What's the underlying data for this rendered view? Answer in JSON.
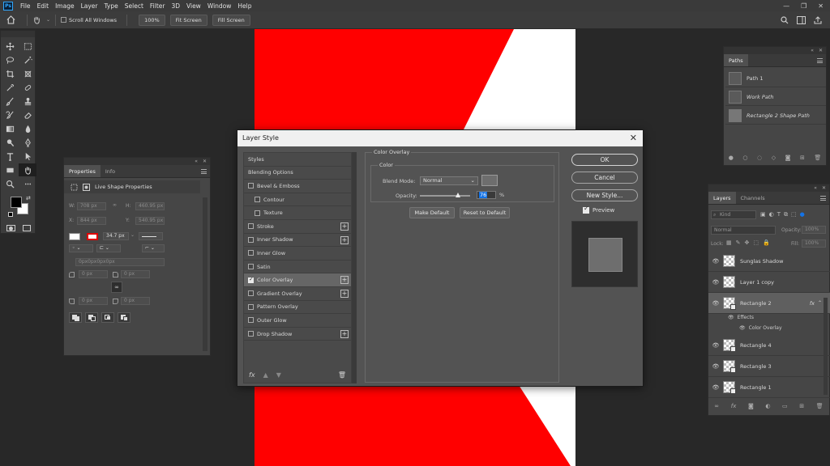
{
  "menubar": {
    "logo": "Ps",
    "items": [
      "File",
      "Edit",
      "Image",
      "Layer",
      "Type",
      "Select",
      "Filter",
      "3D",
      "View",
      "Window",
      "Help"
    ],
    "controls": [
      "—",
      "❐",
      "✕"
    ]
  },
  "options_bar": {
    "scroll_all_windows": "Scroll All Windows",
    "zoom": "100%",
    "fit_screen": "Fit Screen",
    "fill_screen": "Fill Screen"
  },
  "properties": {
    "tabs": [
      "Properties",
      "Info"
    ],
    "header": "Live Shape Properties",
    "w_label": "W:",
    "w_value": "708 px",
    "h_label": "H:",
    "h_value": "460.95 px",
    "x_label": "X:",
    "x_value": "844 px",
    "y_label": "Y:",
    "y_value": "540.95 px",
    "stroke_width": "34.7 px",
    "corner_values": [
      "0 px",
      "0 px",
      "0 px",
      "0 px"
    ],
    "radius_placeholder": "0px0px0px0px"
  },
  "dialog": {
    "title": "Layer Style",
    "close": "✕",
    "styles": [
      {
        "label": "Styles",
        "kind": "header"
      },
      {
        "label": "Blending Options",
        "kind": "header"
      },
      {
        "label": "Bevel & Emboss",
        "kind": "check",
        "checked": false
      },
      {
        "label": "Contour",
        "kind": "sub",
        "checked": false
      },
      {
        "label": "Texture",
        "kind": "sub",
        "checked": false
      },
      {
        "label": "Stroke",
        "kind": "check",
        "checked": false,
        "plus": true
      },
      {
        "label": "Inner Shadow",
        "kind": "check",
        "checked": false,
        "plus": true
      },
      {
        "label": "Inner Glow",
        "kind": "check",
        "checked": false
      },
      {
        "label": "Satin",
        "kind": "check",
        "checked": false
      },
      {
        "label": "Color Overlay",
        "kind": "check",
        "checked": true,
        "plus": true,
        "active": true
      },
      {
        "label": "Gradient Overlay",
        "kind": "check",
        "checked": false,
        "plus": true
      },
      {
        "label": "Pattern Overlay",
        "kind": "check",
        "checked": false
      },
      {
        "label": "Outer Glow",
        "kind": "check",
        "checked": false
      },
      {
        "label": "Drop Shadow",
        "kind": "check",
        "checked": false,
        "plus": true
      }
    ],
    "fx": "fx",
    "section_title": "Color Overlay",
    "color_group": "Color",
    "blend_mode_label": "Blend Mode:",
    "blend_mode_value": "Normal",
    "overlay_color": "#6e6e6e",
    "opacity_label": "Opacity:",
    "opacity_value": "76",
    "opacity_fraction": 0.76,
    "opacity_unit": "%",
    "make_default": "Make Default",
    "reset_to_default": "Reset to Default",
    "ok": "OK",
    "cancel": "Cancel",
    "new_style": "New Style...",
    "preview_label": "Preview",
    "preview_checked": true
  },
  "paths": {
    "tab": "Paths",
    "items": [
      "Path 1",
      "Work Path",
      "Rectangle 2 Shape Path"
    ]
  },
  "layers": {
    "tabs": [
      "Layers",
      "Channels"
    ],
    "kind_label": "Kind",
    "blend_mode": "Normal",
    "opacity_label": "Opacity:",
    "opacity_value": "100%",
    "lock_label": "Lock:",
    "fill_label": "Fill:",
    "fill_value": "100%",
    "items": [
      {
        "name": "Sunglas Shadow",
        "shape": false
      },
      {
        "name": "Layer 1 copy",
        "shape": false
      },
      {
        "name": "Rectangle 2",
        "shape": true,
        "selected": true,
        "fx": "fx"
      },
      {
        "name": "Rectangle 4",
        "shape": true
      },
      {
        "name": "Rectangle 3",
        "shape": true
      },
      {
        "name": "Rectangle 1",
        "shape": true
      }
    ],
    "effects_label": "Effects",
    "color_overlay_label": "Color Overlay"
  },
  "colors": {
    "canvas_red": "#ff0000",
    "foreground": "#000000",
    "background": "#ffffff",
    "accent_blue": "#1473e6"
  }
}
